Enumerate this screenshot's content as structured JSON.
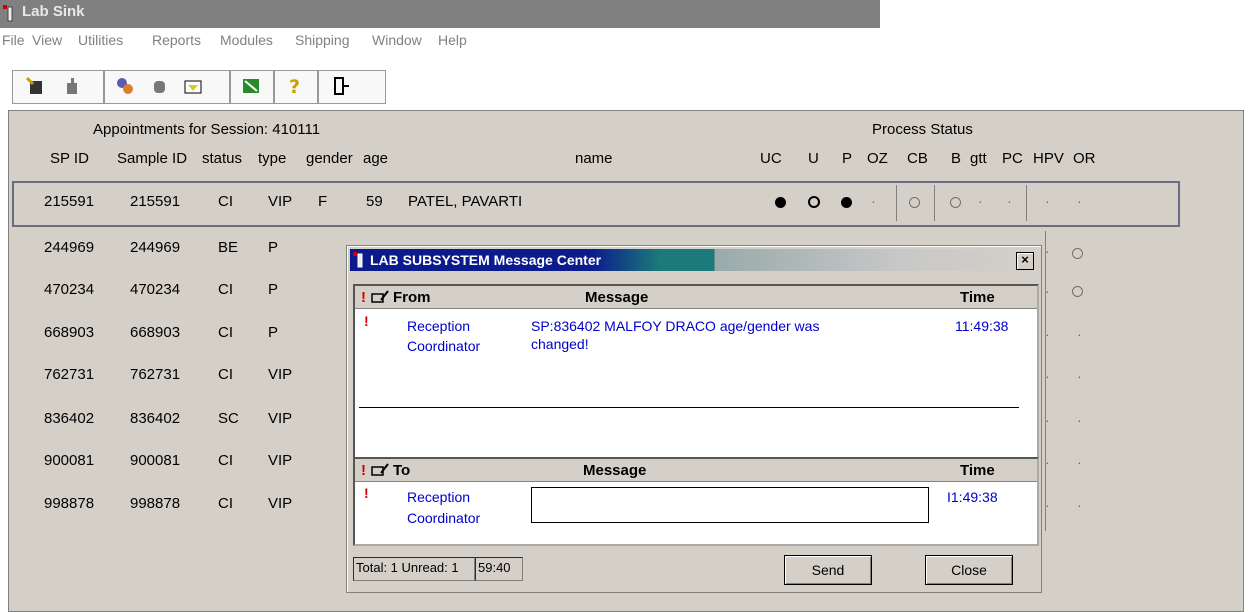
{
  "window": {
    "title": "Lab Sink"
  },
  "menu": [
    "File",
    "View",
    "Utilities",
    "Reports",
    "Modules",
    "Shipping",
    "Window",
    "Help"
  ],
  "toolbar_icons": [
    "new-icon",
    "pointer-icon",
    "group-icon",
    "hand-icon",
    "tag-icon",
    "specimen-icon",
    "help-icon",
    "exit-icon"
  ],
  "appointments": {
    "session_label": "Appointments for Session: 410111",
    "process_status_label": "Process Status",
    "columns": [
      "SP ID",
      "Sample ID",
      "status",
      "type",
      "gender",
      "age",
      "name"
    ],
    "status_columns": [
      "UC",
      "U",
      "P",
      "OZ",
      "CB",
      "B",
      "gtt",
      "PC",
      "HPV",
      "OR"
    ],
    "rows": [
      {
        "sp_id": "215591",
        "sample_id": "215591",
        "status": "CI",
        "type": "VIP",
        "gender": "F",
        "age": "59",
        "name": "PATEL, PAVARTI"
      },
      {
        "sp_id": "244969",
        "sample_id": "244969",
        "status": "BE",
        "type": "P"
      },
      {
        "sp_id": "470234",
        "sample_id": "470234",
        "status": "CI",
        "type": "P"
      },
      {
        "sp_id": "668903",
        "sample_id": "668903",
        "status": "CI",
        "type": "P"
      },
      {
        "sp_id": "762731",
        "sample_id": "762731",
        "status": "CI",
        "type": "VIP"
      },
      {
        "sp_id": "836402",
        "sample_id": "836402",
        "status": "SC",
        "type": "VIP"
      },
      {
        "sp_id": "900081",
        "sample_id": "900081",
        "status": "CI",
        "type": "VIP"
      },
      {
        "sp_id": "998878",
        "sample_id": "998878",
        "status": "CI",
        "type": "VIP"
      }
    ]
  },
  "dialog": {
    "title": "LAB SUBSYSTEM Message Center",
    "close_glyph": "×",
    "from_header": {
      "flag": "!",
      "icon": "envelope-pen-icon",
      "from": "From",
      "message": "Message",
      "time": "Time"
    },
    "from_row": {
      "flag": "!",
      "from_line1": "Reception",
      "from_line2": "Coordinator",
      "message_line1": "SP:836402 MALFOY DRACO age/gender was",
      "message_line2": "changed!",
      "time": "11:49:38"
    },
    "to_header": {
      "flag": "!",
      "to": "To",
      "message": "Message",
      "time": "Time"
    },
    "to_row": {
      "flag": "!",
      "to_line1": "Reception",
      "to_line2": "Coordinator",
      "message_value": "",
      "time": "I1:49:38"
    },
    "status_total": "Total: 1 Unread: 1",
    "status_timer": "59:40",
    "send_label": "Send",
    "close_label": "Close"
  }
}
